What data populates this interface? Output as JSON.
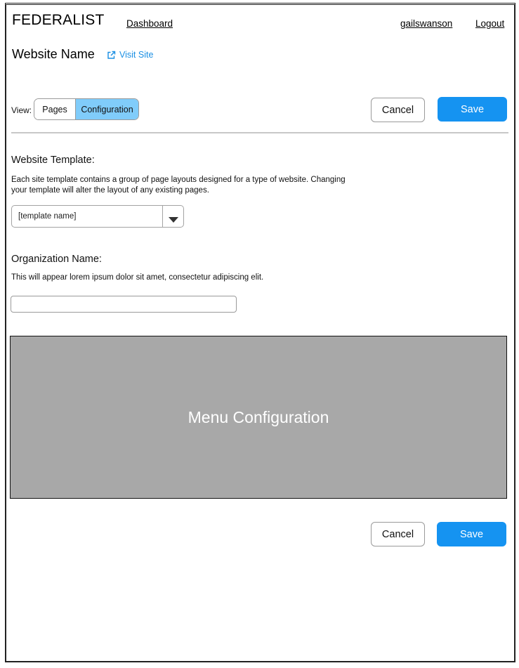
{
  "header": {
    "brand": "FEDERALIST",
    "dashboard_link": "Dashboard",
    "username": "gailswanson",
    "logout_link": "Logout"
  },
  "site": {
    "name": "Website Name",
    "visit_link": "Visit Site"
  },
  "view_toggle": {
    "label": "View:",
    "options": [
      "Pages",
      "Configuration"
    ],
    "selected": "Configuration"
  },
  "actions": {
    "cancel_label": "Cancel",
    "save_label": "Save"
  },
  "template_section": {
    "title": "Website Template:",
    "description_line1": "Each site template contains a group of page layouts designed for a type of website. Changing",
    "description_line2": "your template will alter the layout of any existing pages.",
    "selected_value": "[template name]"
  },
  "organization_section": {
    "title": "Organization Name:",
    "description": "This will appear lorem ipsum dolor sit amet, consectetur adipiscing elit.",
    "value": ""
  },
  "menu_placeholder": {
    "label": "Menu Configuration"
  },
  "colors": {
    "accent": "#1593f1",
    "selected_tab": "#80ccfa",
    "link": "#1a8fe3",
    "placeholder_box": "#a8a8a8"
  },
  "icons": {
    "visit_site": "external-link-icon",
    "select": "caret-down-icon"
  }
}
